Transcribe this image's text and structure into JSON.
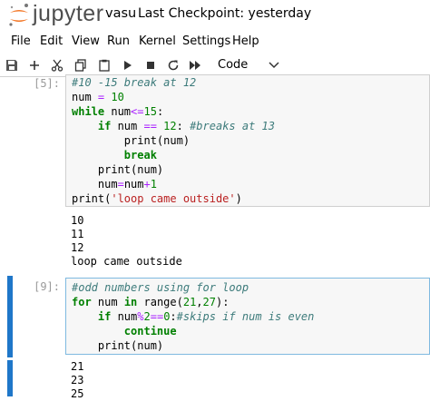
{
  "header": {
    "logo_text": "jupyter",
    "notebook_name": "vasu",
    "checkpoint": "Last Checkpoint: yesterday"
  },
  "menu": [
    "File",
    "Edit",
    "View",
    "Run",
    "Kernel",
    "Settings",
    "Help"
  ],
  "toolbar": {
    "cell_type": "Code",
    "icons": [
      "save-icon",
      "plus-icon",
      "cut-icon",
      "copy-icon",
      "paste-icon",
      "run-icon",
      "stop-icon",
      "restart-icon",
      "fast-forward-icon"
    ]
  },
  "cells": [
    {
      "prompt": "[5]:",
      "code_lines": [
        "#10 -15 break at 12",
        "num = 10",
        "while num<=15:",
        "    if num == 12: #breaks at 13",
        "        print(num)",
        "        break",
        "    print(num)",
        "    num=num+1",
        "print('loop came outside')"
      ],
      "output_lines": [
        "10",
        "11",
        "12",
        "loop came outside"
      ]
    },
    {
      "prompt": "[9]:",
      "code_lines": [
        "#odd numbers using for loop",
        "for num in range(21,27):",
        "    if num%2==0:#skips if num is even",
        "        continue",
        "    print(num)"
      ],
      "output_lines": [
        "21",
        "23",
        "25"
      ]
    }
  ],
  "colors": {
    "keyword": "#008000",
    "comment": "#3d7b7b",
    "operator": "#aa22ff",
    "string": "#ba2121",
    "selection_bar": "#1f77c9",
    "logo_orange": "#f37726"
  }
}
